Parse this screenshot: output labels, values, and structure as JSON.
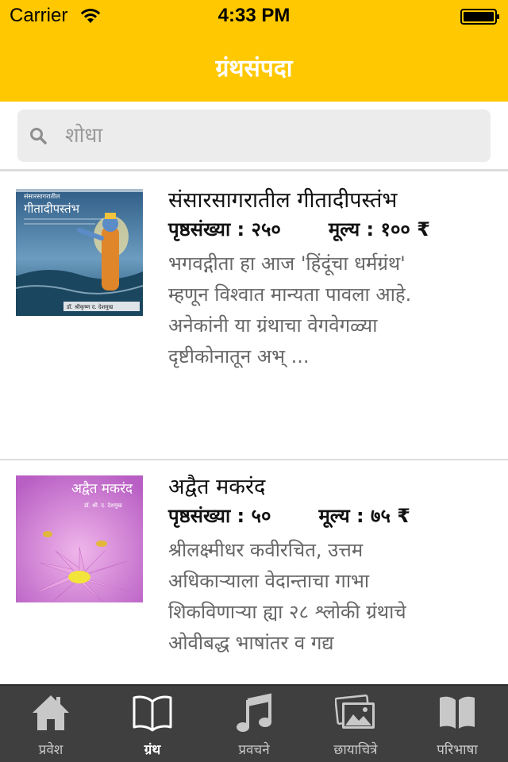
{
  "status_bar": {
    "carrier": "Carrier",
    "time": "4:33 PM",
    "icons": [
      "wifi-icon",
      "battery-icon"
    ]
  },
  "nav": {
    "title": "ग्रंथसंपदा"
  },
  "search": {
    "placeholder": "शोधा",
    "value": "",
    "icon": "search-icon"
  },
  "books": [
    {
      "title": "संसारसागरातील गीतादीपस्तंभ",
      "pages_label": "पृष्ठसंख्या : २५०",
      "price_label": "मूल्य : १०० ₹",
      "description": "भगवद्गीता हा आज 'हिंदूंचा धर्मग्रंथ' म्हणून विश्वात मान्यता पावला आहे. अनेकांनी या ग्रंथाचा वेगवेगळ्या दृष्टीकोनातून अभ् ...",
      "cover": {
        "title_text": "गीतादीपस्तंभ",
        "subtitle_text": "संसारसागरातील",
        "author_text": "डॉ. श्रीकृष्ण द. देशमुख",
        "colors": {
          "sky": "#3a6e9e",
          "sea": "#1d4e6a",
          "figure": "#e0862a"
        }
      }
    },
    {
      "title": "अद्वैत मकरंद",
      "pages_label": "पृष्ठसंख्या : ५०",
      "price_label": "मूल्य : ७५ ₹",
      "description": "श्रीलक्ष्मीधर कवीरचित, उत्तम अधिकाऱ्याला वेदान्ताचा गाभा शिकविणाऱ्या ह्या २८ श्लोकी ग्रंथाचे ओवीबद्ध भाषांतर व गद्य",
      "cover": {
        "title_text": "अद्वैत मकरंद",
        "author_text": "डॉ. श्री. द. देशमुख",
        "colors": {
          "bg": "#d27ad6",
          "flower": "#e2a2dc",
          "center": "#f2e43a"
        }
      }
    }
  ],
  "tabs": [
    {
      "label": "प्रवेश",
      "icon": "home-icon",
      "active": false
    },
    {
      "label": "ग्रंथ",
      "icon": "open-book-icon",
      "active": true
    },
    {
      "label": "प्रवचने",
      "icon": "music-note-icon",
      "active": false
    },
    {
      "label": "छायाचित्रे",
      "icon": "photos-icon",
      "active": false
    },
    {
      "label": "परिभाषा",
      "icon": "closed-book-icon",
      "active": false
    }
  ],
  "colors": {
    "accent": "#ffc800",
    "tab_bar": "#3f3f3f",
    "description_text": "#666666"
  }
}
